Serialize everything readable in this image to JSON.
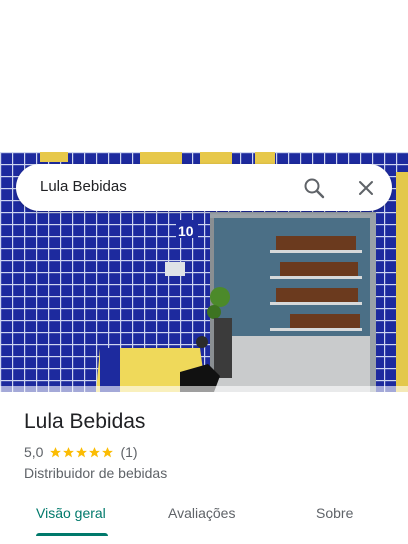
{
  "search": {
    "query": "Lula Bebidas"
  },
  "place": {
    "name": "Lula Bebidas",
    "rating": "5,0",
    "stars": 5,
    "review_count": "(1)",
    "category": "Distribuidor de bebidas"
  },
  "tabs": [
    {
      "label": "Visão geral",
      "active": true
    },
    {
      "label": "Avaliações",
      "active": false
    },
    {
      "label": "Sobre",
      "active": false
    }
  ],
  "photo": {
    "door_number": "10"
  },
  "colors": {
    "accent": "#00796b",
    "star": "#fbbc04",
    "tile": "#1d2a9e",
    "text_primary": "#202124",
    "text_secondary": "#5f6368"
  }
}
